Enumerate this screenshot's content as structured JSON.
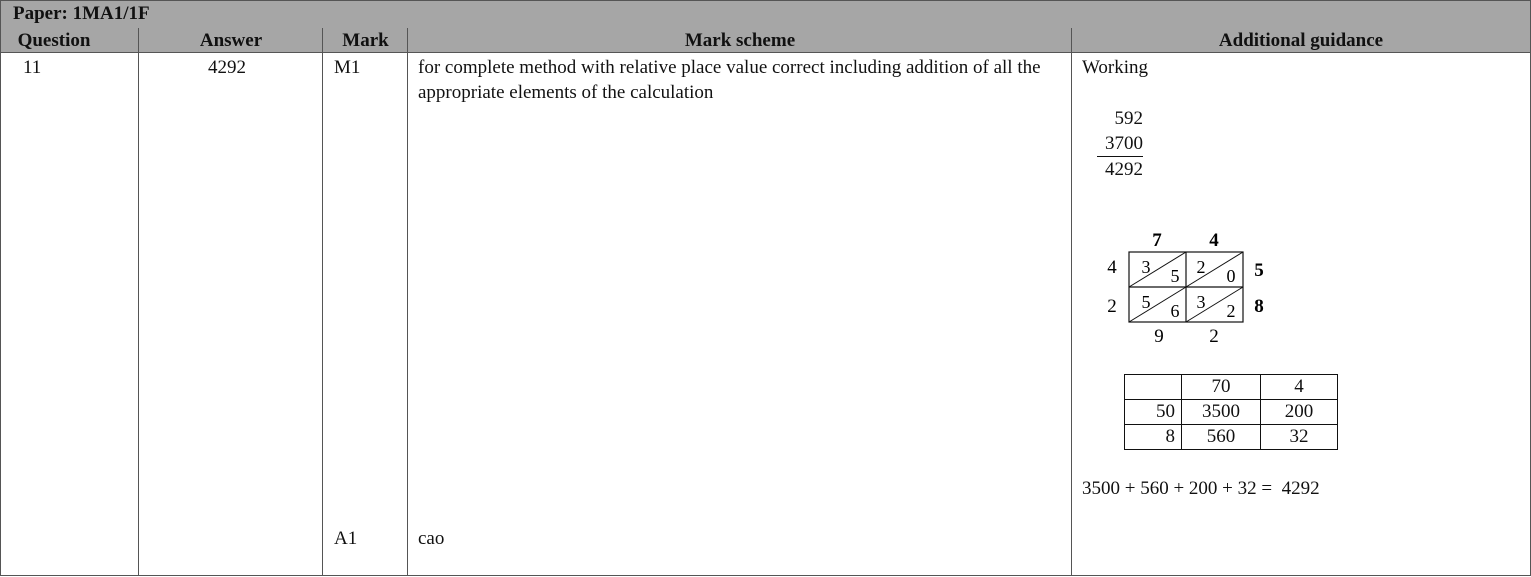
{
  "paper": {
    "title": "Paper: 1MA1/1F"
  },
  "headers": {
    "question": "Question",
    "answer": "Answer",
    "mark": "Mark",
    "mark_scheme": "Mark scheme",
    "guidance": "Additional guidance"
  },
  "row": {
    "question": "11",
    "answer": "4292",
    "marks": [
      {
        "code": "M1",
        "scheme": "for complete method with relative place value correct including addition of all the appropriate elements of the calculation"
      },
      {
        "code": "A1",
        "scheme": "cao"
      }
    ]
  },
  "guidance": {
    "working_label": "Working",
    "column_addition": [
      "592",
      "3700",
      "4292"
    ],
    "lattice": {
      "top": [
        "7",
        "4"
      ],
      "left": [
        "4",
        "2"
      ],
      "right": [
        "5",
        "8"
      ],
      "bottom": [
        "9",
        "2"
      ],
      "cells": [
        {
          "tens": "3",
          "units": "5"
        },
        {
          "tens": "2",
          "units": "0"
        },
        {
          "tens": "5",
          "units": "6"
        },
        {
          "tens": "3",
          "units": "2"
        }
      ]
    },
    "grid_method": {
      "header": [
        "",
        "70",
        "4"
      ],
      "rows": [
        [
          "50",
          "3500",
          "200"
        ],
        [
          "8",
          "560",
          "32"
        ]
      ]
    },
    "sum": "3500 + 560 + 200 + 32 =  4292"
  }
}
